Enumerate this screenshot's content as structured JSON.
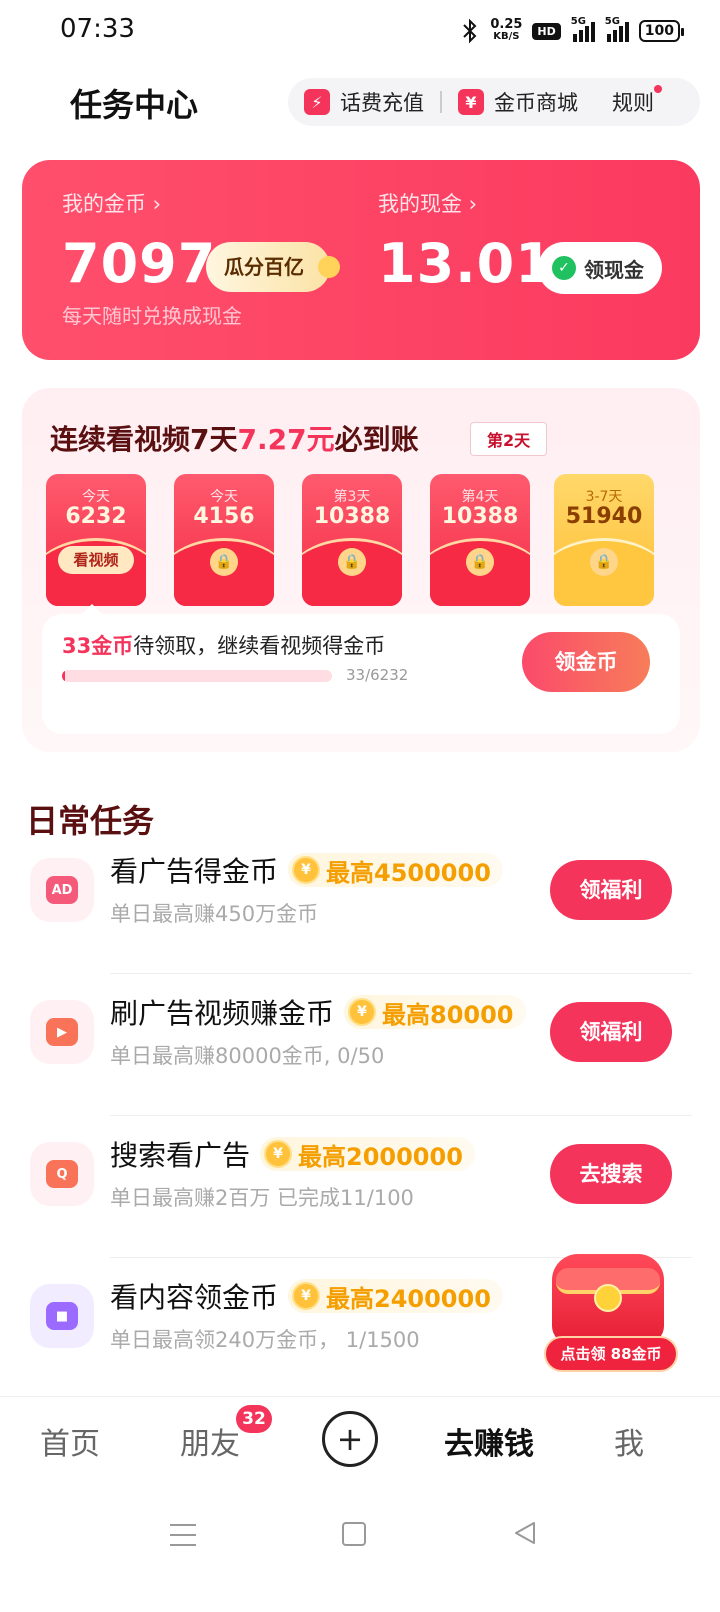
{
  "status_bar": {
    "time": "07:33",
    "net_speed": "0.25",
    "net_unit": "KB/S",
    "hd": "HD",
    "signal1": "5G",
    "signal2": "5G",
    "battery": "100"
  },
  "header": {
    "title": "任务中心",
    "recharge_label": "话费充值",
    "shop_label": "金币商城",
    "rules_label": "规则"
  },
  "wallet": {
    "coins_label": "我的金币 ›",
    "coins_value": "7097",
    "coins_badge": "瓜分百亿",
    "cash_label": "我的现金 ›",
    "cash_value": "13.01",
    "cash_button": "领现金",
    "subtitle": "每天随时兑换成现金"
  },
  "streak": {
    "title_a": "连续看视频7天",
    "title_amount": "7.27元",
    "title_b": "必到账",
    "day_badge": "第2天",
    "envelopes": [
      {
        "day": "今天",
        "value": "6232",
        "action": "看视频",
        "locked": false
      },
      {
        "day": "今天",
        "value": "4156",
        "locked": true
      },
      {
        "day": "第3天",
        "value": "10388",
        "locked": true
      },
      {
        "day": "第4天",
        "value": "10388",
        "locked": true
      },
      {
        "day": "3-7天",
        "value": "51940",
        "locked": true
      }
    ],
    "pending_coins": "33金币",
    "pending_text": "待领取，继续看视频得金币",
    "progress_text": "33/6232",
    "progress_fraction": 0.0053,
    "claim_button": "领金币"
  },
  "daily": {
    "title": "日常任务",
    "tasks": [
      {
        "icon": "ad-icon",
        "icon_text": "AD",
        "title": "看广告得金币",
        "max": "最高4500000",
        "sub": "单日最高赚450万金币",
        "button": "领福利"
      },
      {
        "icon": "video-play-icon",
        "icon_text": "▶",
        "title": "刷广告视频赚金币",
        "max": "最高80000",
        "sub": "单日最高赚80000金币, 0/50",
        "button": "领福利"
      },
      {
        "icon": "search-play-icon",
        "icon_text": "Q",
        "title": "搜索看广告",
        "max": "最高2000000",
        "sub": "单日最高赚2百万 已完成11/100",
        "button": "去搜索"
      },
      {
        "icon": "video-camera-icon",
        "icon_text": "■",
        "title": "看内容领金币",
        "max": "最高2400000",
        "sub": "单日最高领240万金币， 1/1500",
        "button": ""
      }
    ],
    "chest_label": "点击领 88金币"
  },
  "coin_symbol": "¥",
  "bottom_nav": {
    "home": "首页",
    "friends": "朋友",
    "friends_badge": "32",
    "add": "+",
    "earn": "去赚钱",
    "me": "我"
  },
  "colors": {
    "accent": "#f5345b",
    "gold": "#f59e00",
    "title_dark": "#5a1010"
  }
}
